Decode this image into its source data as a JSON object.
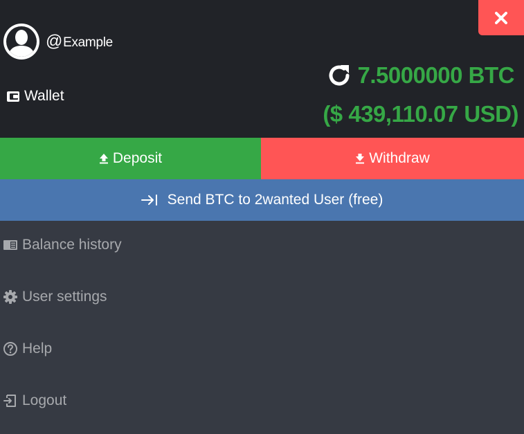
{
  "header": {
    "username_at": "@",
    "username": "Example",
    "wallet_label": "Wallet",
    "balance_btc": "7.5000000 BTC",
    "balance_usd": "($ 439,110.07 USD)"
  },
  "actions": {
    "deposit_label": "Deposit",
    "withdraw_label": "Withdraw",
    "send_label": "Send BTC to 2wanted User (free)"
  },
  "menu": [
    {
      "label": "Balance history",
      "icon": "book-icon"
    },
    {
      "label": "User settings",
      "icon": "gear-icon"
    },
    {
      "label": "Help",
      "icon": "help-icon"
    },
    {
      "label": "Logout",
      "icon": "logout-icon"
    }
  ],
  "colors": {
    "header_bg": "#212328",
    "body_bg": "#363a43",
    "accent_green": "#36a846",
    "accent_red": "#ff5555",
    "accent_blue": "#4a76af",
    "menu_text": "#a7a9ad"
  }
}
